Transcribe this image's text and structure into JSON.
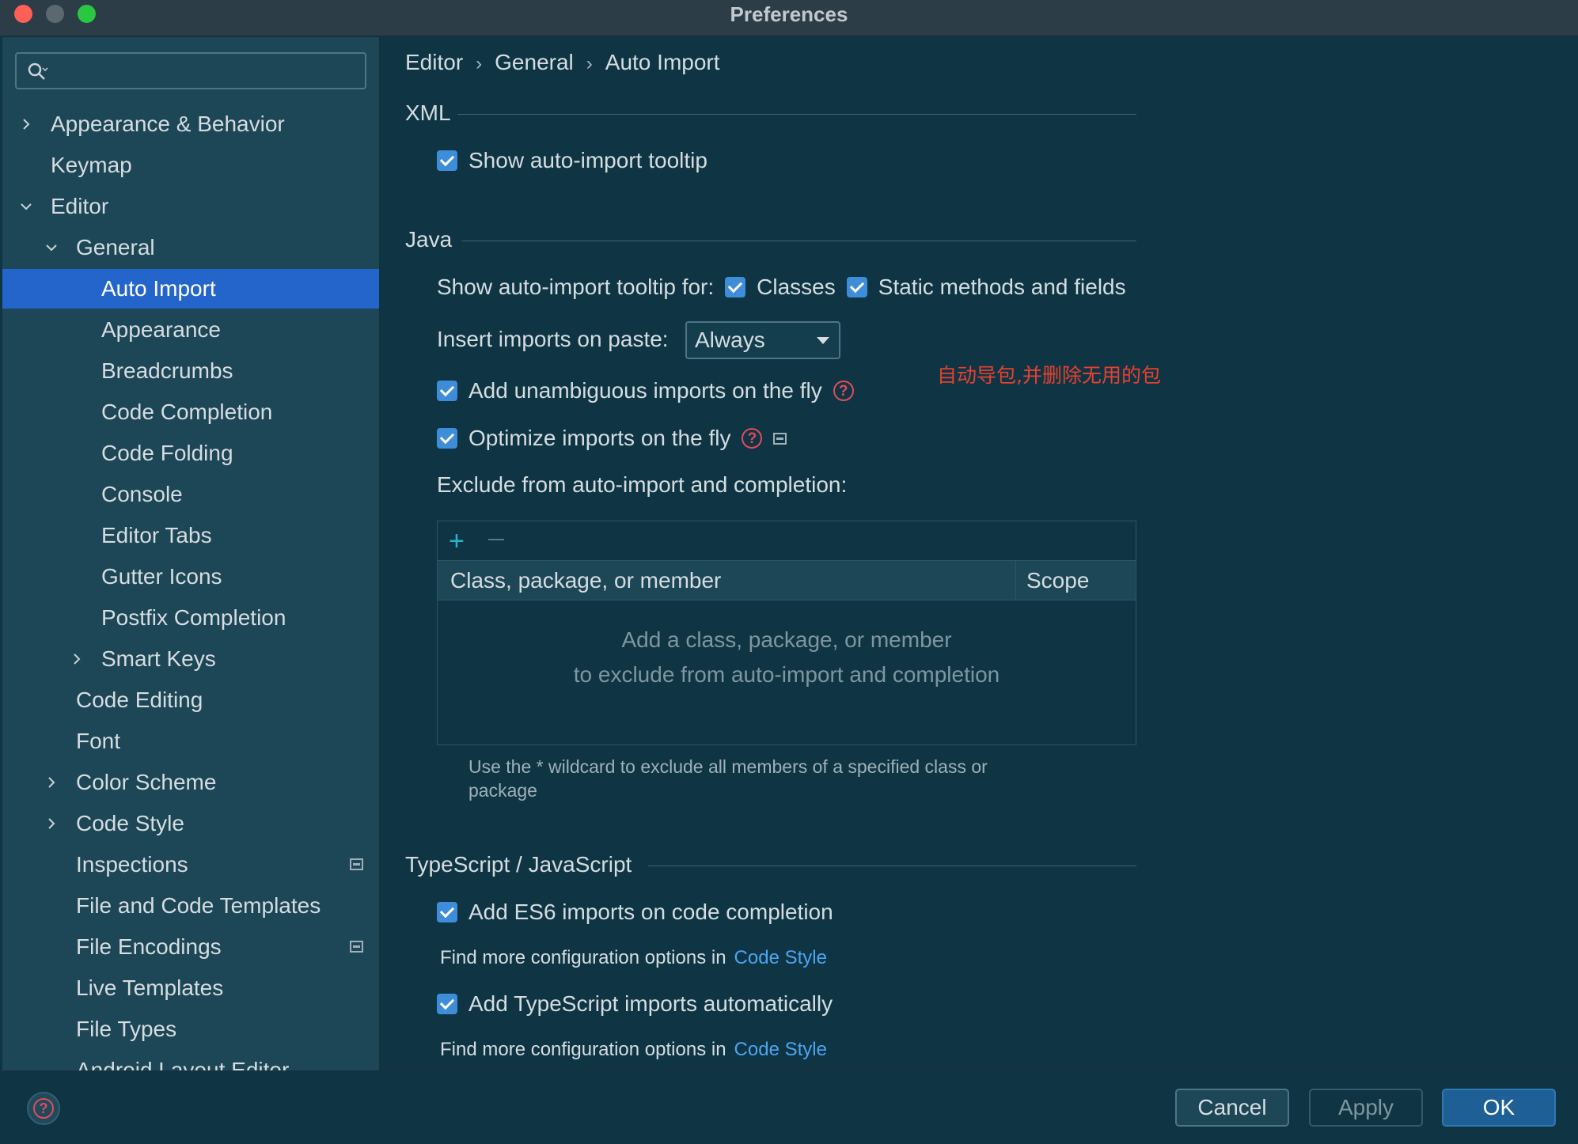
{
  "window": {
    "title": "Preferences"
  },
  "sidebar": {
    "search_placeholder": "",
    "items": [
      {
        "label": "Appearance & Behavior",
        "indent": 0,
        "chevron": "right"
      },
      {
        "label": "Keymap",
        "indent": 0,
        "chevron": "none"
      },
      {
        "label": "Editor",
        "indent": 0,
        "chevron": "down"
      },
      {
        "label": "General",
        "indent": 1,
        "chevron": "down"
      },
      {
        "label": "Auto Import",
        "indent": 2,
        "chevron": "none",
        "selected": true
      },
      {
        "label": "Appearance",
        "indent": 2,
        "chevron": "none"
      },
      {
        "label": "Breadcrumbs",
        "indent": 2,
        "chevron": "none"
      },
      {
        "label": "Code Completion",
        "indent": 2,
        "chevron": "none"
      },
      {
        "label": "Code Folding",
        "indent": 2,
        "chevron": "none"
      },
      {
        "label": "Console",
        "indent": 2,
        "chevron": "none"
      },
      {
        "label": "Editor Tabs",
        "indent": 2,
        "chevron": "none"
      },
      {
        "label": "Gutter Icons",
        "indent": 2,
        "chevron": "none"
      },
      {
        "label": "Postfix Completion",
        "indent": 2,
        "chevron": "none"
      },
      {
        "label": "Smart Keys",
        "indent": 2,
        "chevron": "right"
      },
      {
        "label": "Code Editing",
        "indent": 1,
        "chevron": "none"
      },
      {
        "label": "Font",
        "indent": 1,
        "chevron": "none"
      },
      {
        "label": "Color Scheme",
        "indent": 1,
        "chevron": "right"
      },
      {
        "label": "Code Style",
        "indent": 1,
        "chevron": "right"
      },
      {
        "label": "Inspections",
        "indent": 1,
        "chevron": "none",
        "project_icon": true
      },
      {
        "label": "File and Code Templates",
        "indent": 1,
        "chevron": "none"
      },
      {
        "label": "File Encodings",
        "indent": 1,
        "chevron": "none",
        "project_icon": true
      },
      {
        "label": "Live Templates",
        "indent": 1,
        "chevron": "none"
      },
      {
        "label": "File Types",
        "indent": 1,
        "chevron": "none"
      },
      {
        "label": "Android Layout Editor",
        "indent": 1,
        "chevron": "none"
      }
    ]
  },
  "breadcrumb": [
    "Editor",
    "General",
    "Auto Import"
  ],
  "xml": {
    "header": "XML",
    "show_tooltip": {
      "label": "Show auto-import tooltip",
      "checked": true
    }
  },
  "java": {
    "header": "Java",
    "tooltip_for_label": "Show auto-import tooltip for:",
    "classes": {
      "label": "Classes",
      "checked": true
    },
    "static_members": {
      "label": "Static methods and fields",
      "checked": true
    },
    "insert_on_paste_label": "Insert imports on paste:",
    "insert_on_paste_value": "Always",
    "add_unambiguous": {
      "label": "Add unambiguous imports on the fly",
      "checked": true
    },
    "optimize_imports": {
      "label": "Optimize imports on the fly",
      "checked": true
    },
    "exclude_label": "Exclude from auto-import and completion:",
    "table": {
      "columns": [
        "Class, package, or member",
        "Scope"
      ],
      "empty_line1": "Add a class, package, or member",
      "empty_line2": "to exclude from auto-import and completion"
    },
    "hint": "Use the * wildcard to exclude all members of a specified class or package"
  },
  "annotation": "自动导包,并删除无用的包",
  "typescript": {
    "header": "TypeScript / JavaScript",
    "es6_imports": {
      "label": "Add ES6 imports on code completion",
      "checked": true
    },
    "find_more_1": "Find more configuration options in",
    "link_1": "Code Style",
    "ts_imports": {
      "label": "Add TypeScript imports automatically",
      "checked": true
    },
    "find_more_2": "Find more configuration options in",
    "link_2": "Code Style"
  },
  "buttons": {
    "cancel": "Cancel",
    "apply": "Apply",
    "ok": "OK"
  },
  "colors": {
    "accent": "#2465cb",
    "checkbox": "#3d8dd8",
    "link": "#4ea4f2",
    "annotation": "#e8402f",
    "background": "#0f3544",
    "sidebar": "#1d4657"
  }
}
